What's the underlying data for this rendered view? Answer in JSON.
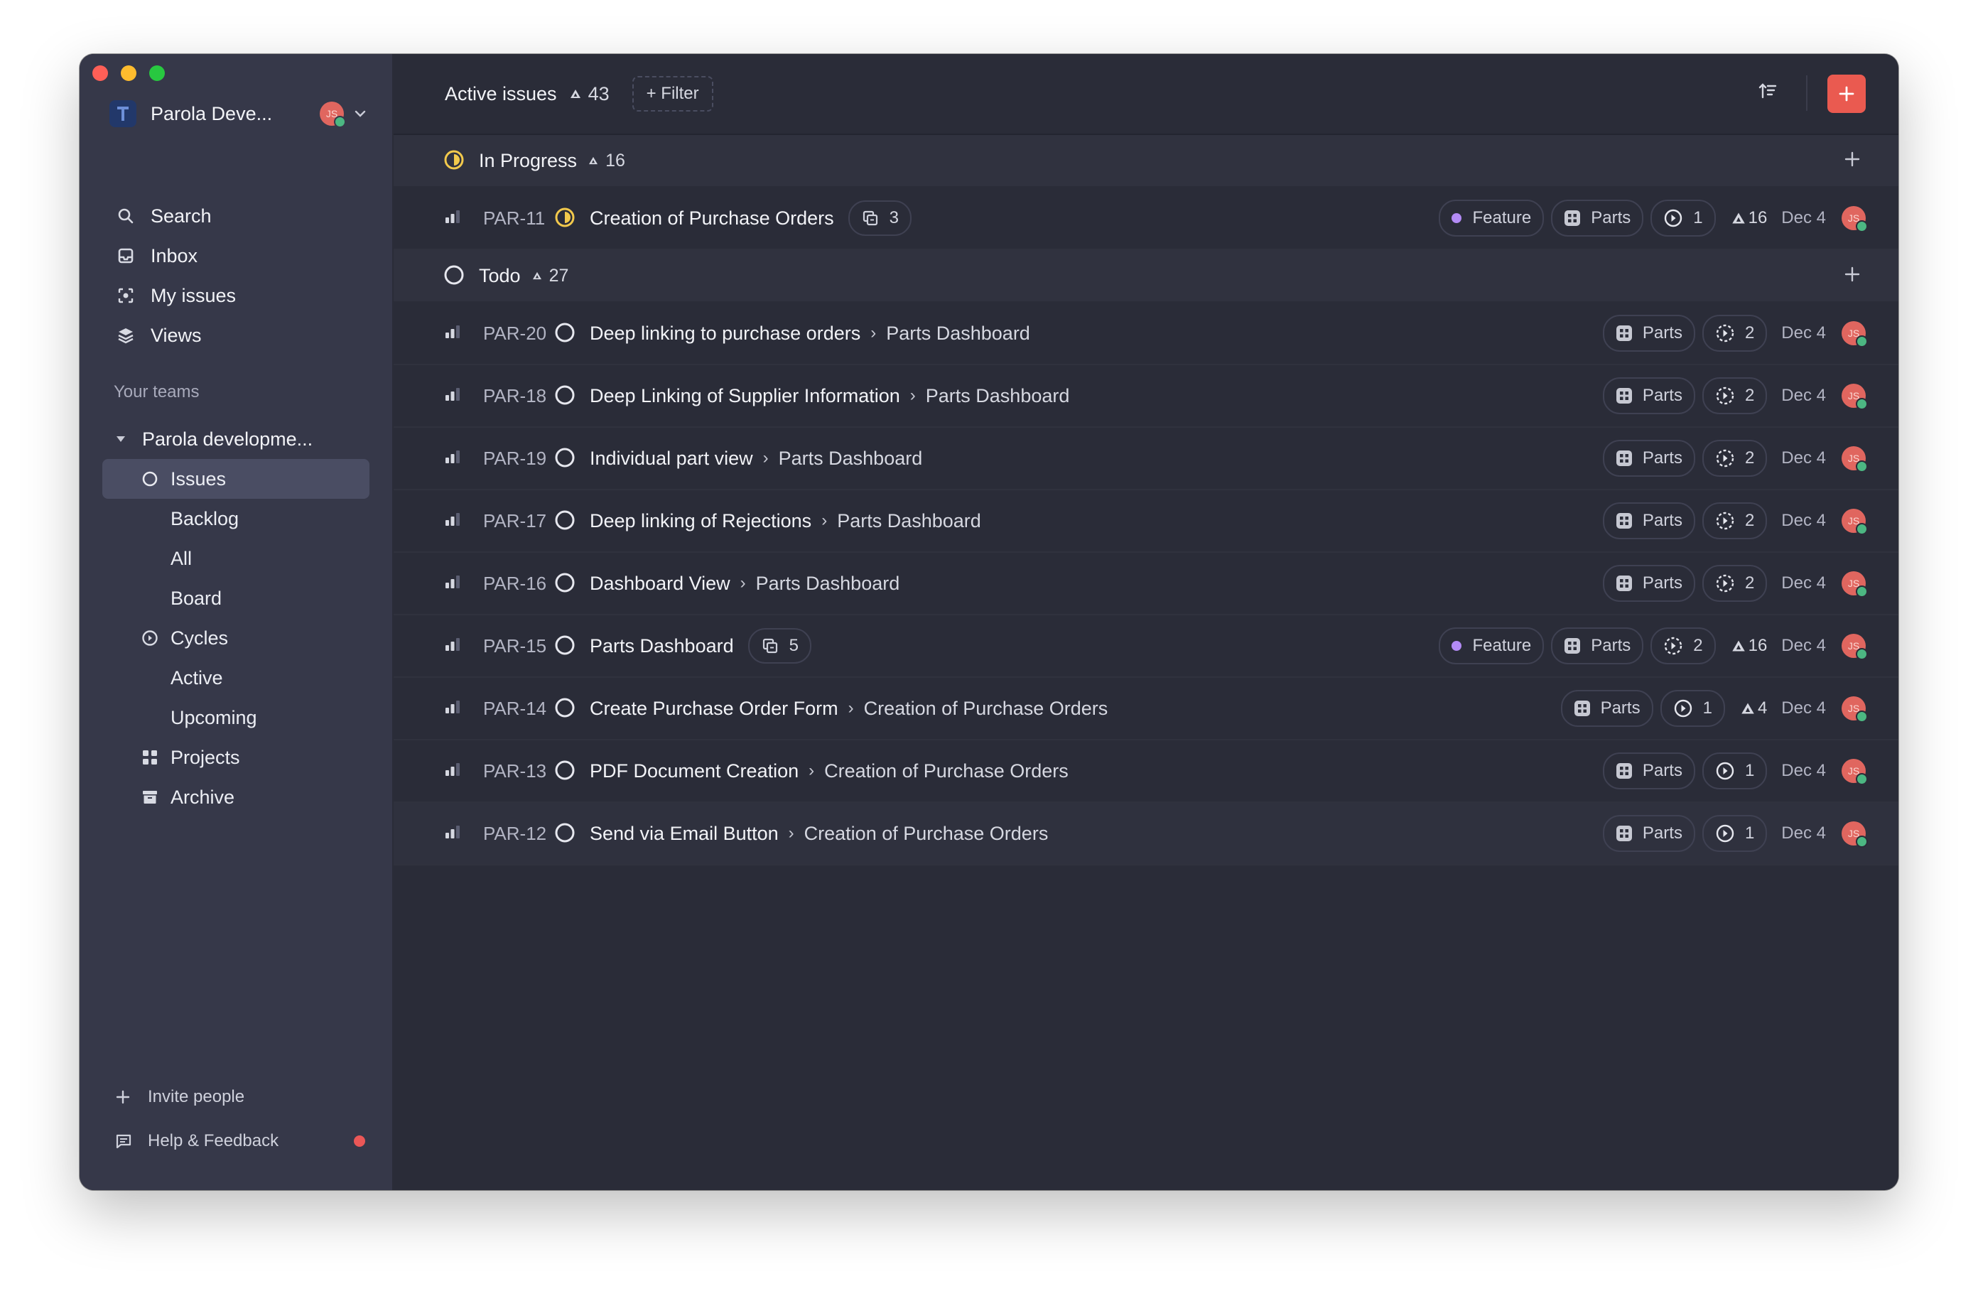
{
  "workspace": {
    "name": "Parola Deve...",
    "avatar_initials": "JS"
  },
  "nav": [
    {
      "label": "Search",
      "icon": "search-icon"
    },
    {
      "label": "Inbox",
      "icon": "inbox-icon"
    },
    {
      "label": "My issues",
      "icon": "my-issues-icon"
    },
    {
      "label": "Views",
      "icon": "views-icon"
    }
  ],
  "teams": {
    "section_label": "Your teams",
    "team_name": "Parola developme...",
    "items": [
      {
        "label": "Issues",
        "icon": "issues-circle-icon",
        "active": true
      },
      {
        "label": "Backlog"
      },
      {
        "label": "All"
      },
      {
        "label": "Board"
      },
      {
        "label": "Cycles",
        "icon": "cycles-icon"
      },
      {
        "label": "Active"
      },
      {
        "label": "Upcoming"
      },
      {
        "label": "Projects",
        "icon": "projects-icon"
      },
      {
        "label": "Archive",
        "icon": "archive-icon"
      }
    ]
  },
  "footer": {
    "invite_label": "Invite people",
    "help_label": "Help & Feedback"
  },
  "header": {
    "title": "Active issues",
    "count": "43",
    "filter_label": "+ Filter"
  },
  "groups": [
    {
      "name": "In Progress",
      "count": "16",
      "status": "in-progress",
      "issues": [
        {
          "id": "PAR-11",
          "title": "Creation of Purchase Orders",
          "subissues": "3",
          "label": "Feature",
          "project": "Parts",
          "cycle": "1",
          "estimate": "16",
          "due": "Dec 4",
          "assignee": "JS"
        }
      ]
    },
    {
      "name": "Todo",
      "count": "27",
      "status": "todo",
      "issues": [
        {
          "id": "PAR-20",
          "title": "Deep linking to purchase orders",
          "parent": "Parts Dashboard",
          "project": "Parts",
          "cycle": "2",
          "due": "Dec 4",
          "assignee": "JS"
        },
        {
          "id": "PAR-18",
          "title": "Deep Linking of Supplier Information",
          "parent": "Parts Dashboard",
          "project": "Parts",
          "cycle": "2",
          "due": "Dec 4",
          "assignee": "JS"
        },
        {
          "id": "PAR-19",
          "title": "Individual part view",
          "parent": "Parts Dashboard",
          "project": "Parts",
          "cycle": "2",
          "due": "Dec 4",
          "assignee": "JS"
        },
        {
          "id": "PAR-17",
          "title": "Deep linking of Rejections",
          "parent": "Parts Dashboard",
          "project": "Parts",
          "cycle": "2",
          "due": "Dec 4",
          "assignee": "JS"
        },
        {
          "id": "PAR-16",
          "title": "Dashboard View",
          "parent": "Parts Dashboard",
          "project": "Parts",
          "cycle": "2",
          "due": "Dec 4",
          "assignee": "JS"
        },
        {
          "id": "PAR-15",
          "title": "Parts Dashboard",
          "subissues": "5",
          "label": "Feature",
          "project": "Parts",
          "cycle": "2",
          "estimate": "16",
          "due": "Dec 4",
          "assignee": "JS"
        },
        {
          "id": "PAR-14",
          "title": "Create Purchase Order Form",
          "parent": "Creation of Purchase Orders",
          "project": "Parts",
          "cycle": "1",
          "estimate": "4",
          "due": "Dec 4",
          "assignee": "JS"
        },
        {
          "id": "PAR-13",
          "title": "PDF Document Creation",
          "parent": "Creation of Purchase Orders",
          "project": "Parts",
          "cycle": "1",
          "due": "Dec 4",
          "assignee": "JS"
        },
        {
          "id": "PAR-12",
          "title": "Send via Email Button",
          "parent": "Creation of Purchase Orders",
          "project": "Parts",
          "cycle": "1",
          "due": "Dec 4",
          "assignee": "JS"
        }
      ]
    }
  ],
  "colors": {
    "accent": "#ea5a50",
    "in_progress": "#f2c94c",
    "label_feature": "#b38bf5",
    "online": "#4cb782"
  }
}
